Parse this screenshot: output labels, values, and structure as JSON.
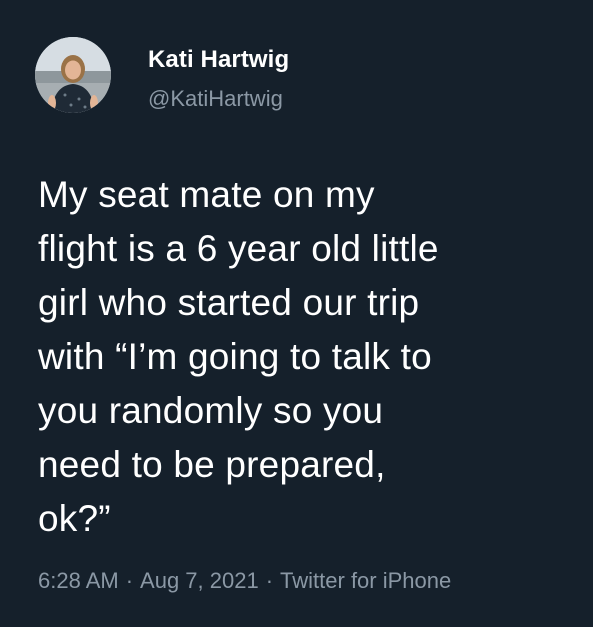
{
  "user": {
    "display_name": "Kati Hartwig",
    "handle": "@KatiHartwig",
    "avatar_icon": "profile-photo"
  },
  "tweet": {
    "text": "My seat mate on my\nflight is a 6 year old little\ngirl who started our trip\nwith “I’m going to talk to\nyou randomly so you\nneed to be prepared,\nok?”"
  },
  "meta": {
    "time": "6:28 AM",
    "date": "Aug 7, 2021",
    "source": "Twitter for iPhone",
    "separator": "·"
  },
  "colors": {
    "background": "#15202b",
    "primary_text": "#ffffff",
    "secondary_text": "#8b98a5"
  }
}
